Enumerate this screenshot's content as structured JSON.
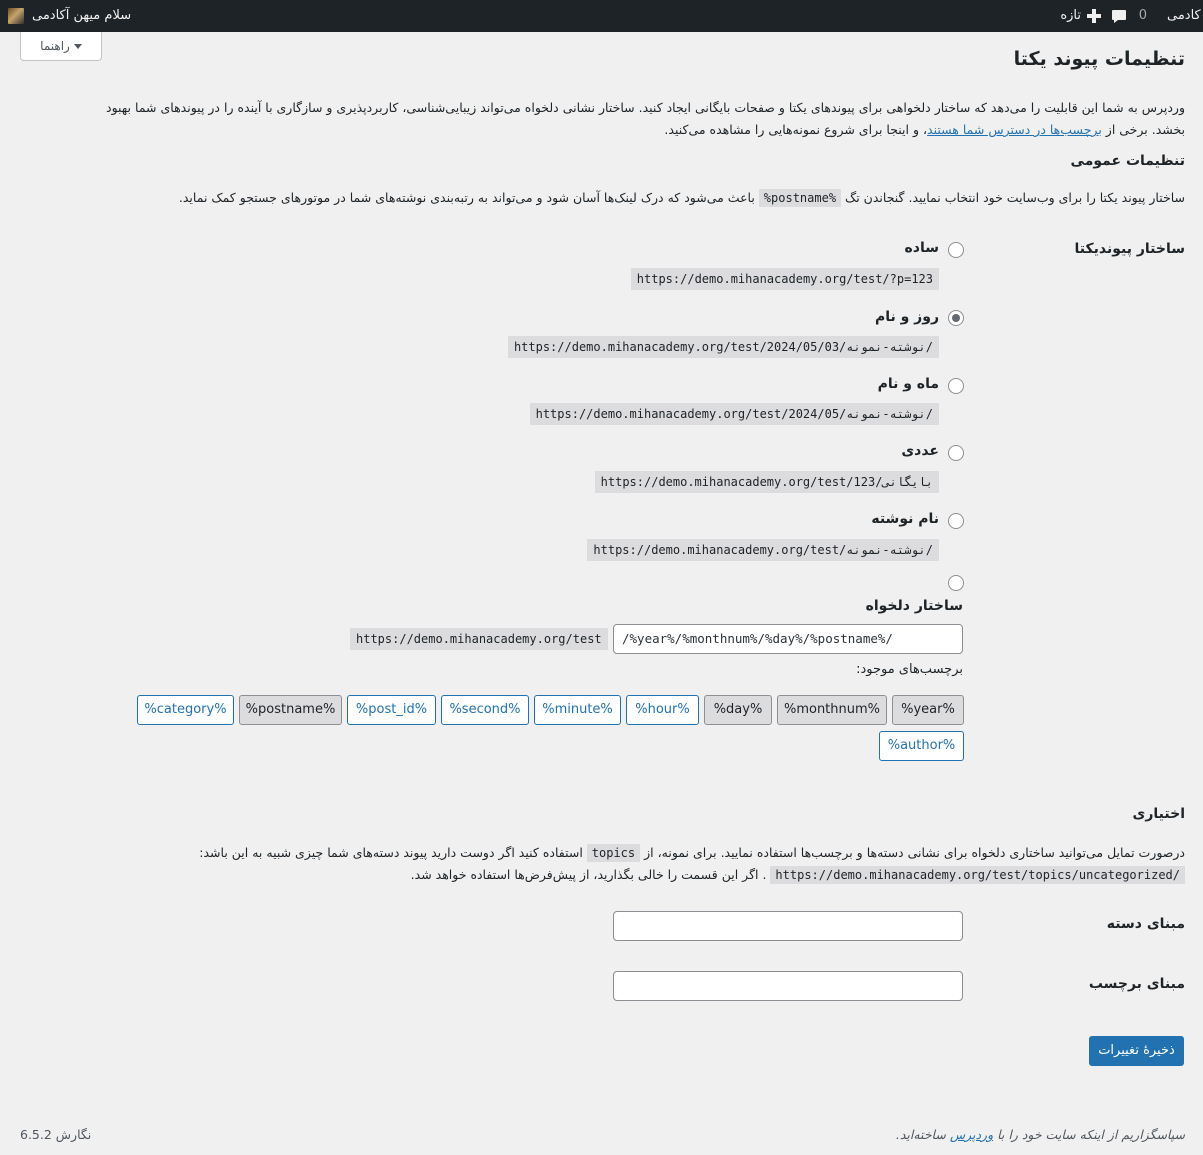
{
  "adminbar": {
    "site_name_partial": "کادمی",
    "new_label": "تازه",
    "comments_count": "0",
    "greeting": "سلام میهن آکادمی"
  },
  "help_tab": {
    "label": "راهنما"
  },
  "page": {
    "title": "تنظیمات پیوند یکتا",
    "intro_line1": "وردپرس به شما این قابلیت را می‌دهد که ساختار دلخواهی برای پیوندهای یکتا و صفحات بایگانی ایجاد کنید. ساختار نشانی دلخواه می‌تواند زیبایی‌شناسی، کاربردپذیری و سازگاری با آینده را در پیوندهای شما بهبود",
    "intro_line2_start": "بخشد. برخی از",
    "intro_link": "برچسب‌ها در دسترس شما هستند",
    "intro_line2_end": "، و اینجا برای شروع نمونه‌هایی را مشاهده می‌کنید."
  },
  "general": {
    "heading": "تنظیمات عمومی",
    "desc_start": "ساختار پیوند یکتا را برای وب‌سایت خود انتخاب نمایید. گنجاندن تگ",
    "desc_code": "%postname%",
    "desc_end": "باعث می‌شود که درک لینک‌ها آسان شود و می‌تواند به رتبه‌بندی نوشته‌های شما در موتورهای جستجو کمک نماید."
  },
  "structure": {
    "label": "ساختار پیوندیکتا",
    "options": [
      {
        "label": "ساده",
        "example": "https://demo.mihanacademy.org/test/?p=123",
        "checked": false
      },
      {
        "label": "روز و نام",
        "example": "https://demo.mihanacademy.org/test/2024/05/03/نوشته-نمونه/",
        "checked": true
      },
      {
        "label": "ماه و نام",
        "example": "https://demo.mihanacademy.org/test/2024/05/نوشته-نمونه/",
        "checked": false
      },
      {
        "label": "عددی",
        "example": "https://demo.mihanacademy.org/test/بایگانی/123",
        "checked": false
      },
      {
        "label": "نام نوشته",
        "example": "https://demo.mihanacademy.org/test/نوشته-نمونه/",
        "checked": false
      }
    ],
    "custom_label": "ساختار دلخواه",
    "custom_prefix": "https://demo.mihanacademy.org/test",
    "custom_value": "/%year%/%monthnum%/%day%/%postname%/",
    "available_tags_label": "برچسب‌های موجود:",
    "tags": [
      {
        "label": "%year%",
        "active": true
      },
      {
        "label": "%monthnum%",
        "active": true
      },
      {
        "label": "%day%",
        "active": true
      },
      {
        "label": "%hour%",
        "active": false
      },
      {
        "label": "%minute%",
        "active": false
      },
      {
        "label": "%second%",
        "active": false
      },
      {
        "label": "%post_id%",
        "active": false
      },
      {
        "label": "%postname%",
        "active": true
      },
      {
        "label": "%category%",
        "active": false
      },
      {
        "label": "%author%",
        "active": false
      }
    ]
  },
  "optional": {
    "heading": "اختیاری",
    "desc_start": "درصورت تمایل می‌توانید ساختاری دلخواه برای نشانی دسته‌ها و برچسب‌ها استفاده نمایید. برای نمونه، از",
    "desc_code": "topics",
    "desc_mid": "استفاده کنید اگر دوست دارید پیوند دسته‌های شما چیزی شبیه به این باشد:",
    "desc_code2": "https://demo.mihanacademy.org/test/topics/uncategorized/",
    "desc_end": ". اگر این قسمت را خالی بگذارید، از پیش‌فرض‌ها استفاده خواهد شد.",
    "category_base_label": "مبنای دسته",
    "tag_base_label": "مبنای برچسب",
    "category_base_value": "",
    "tag_base_value": ""
  },
  "save_button": "ذخیرهٔ تغییرات",
  "footer": {
    "thanks_start": "سپاسگزاریم از اینکه سایت خود را با",
    "thanks_link": "وردپرس",
    "thanks_end": "ساخته‌اید.",
    "version": "نگارش 6.5.2"
  }
}
